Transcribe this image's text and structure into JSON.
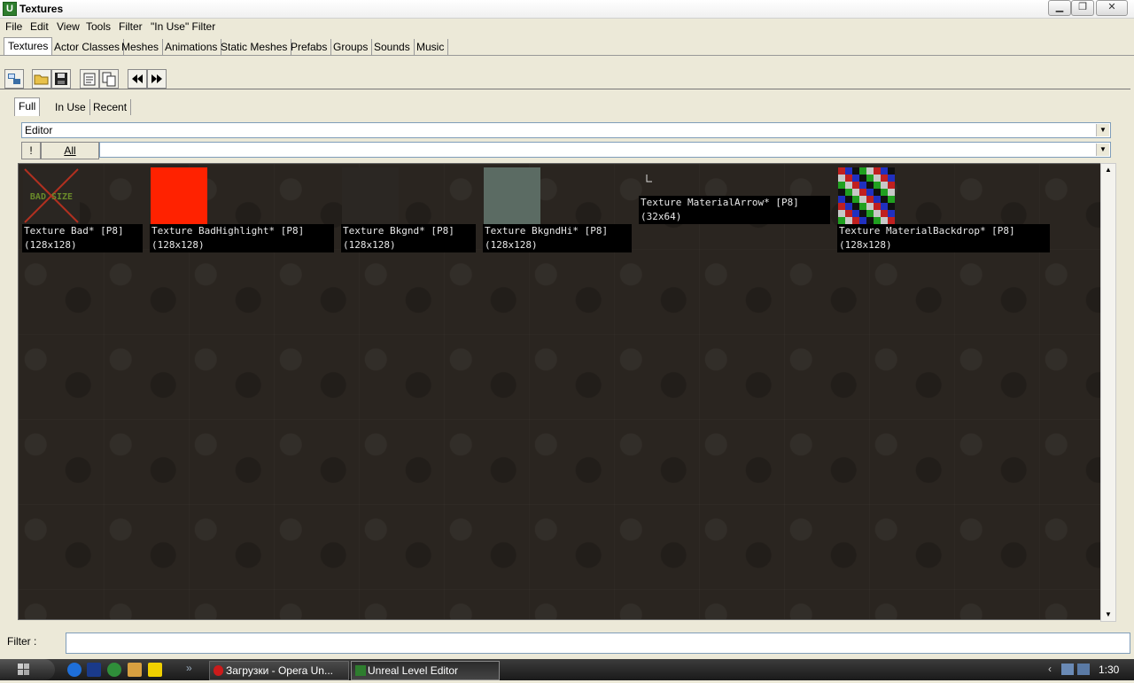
{
  "window": {
    "title": "Textures",
    "app_icon": "U"
  },
  "menu": [
    "File",
    "Edit",
    "View",
    "Tools",
    "Filter",
    "\"In Use\" Filter"
  ],
  "tabs": [
    "Textures",
    "Actor Classes",
    "Meshes",
    "Animations",
    "Static Meshes",
    "Prefabs",
    "Groups",
    "Sounds",
    "Music"
  ],
  "toolbar_icons": [
    "sync-icon",
    "open-folder-icon",
    "save-icon",
    "properties-icon",
    "copy-icon",
    "rewind-icon",
    "fast-forward-icon"
  ],
  "subtabs": [
    "Full",
    "In Use",
    "Recent"
  ],
  "package_combo": {
    "value": "Editor"
  },
  "group_bar": {
    "exclaim_label": "!",
    "all_label": "All",
    "value": ""
  },
  "textures": [
    {
      "name": "Texture Bad* [P8]",
      "size": "(128x128)",
      "thumb_text": "BAD SIZE"
    },
    {
      "name": "Texture BadHighlight* [P8]",
      "size": "(128x128)"
    },
    {
      "name": "Texture Bkgnd* [P8]",
      "size": "(128x128)"
    },
    {
      "name": "Texture BkgndHi* [P8]",
      "size": "(128x128)"
    },
    {
      "name": "Texture MaterialArrow* [P8]",
      "size": "(32x64)"
    },
    {
      "name": "Texture MaterialBackdrop* [P8]",
      "size": "(128x128)"
    }
  ],
  "filter": {
    "label": "Filter :",
    "value": ""
  },
  "taskbar": {
    "tasks": [
      {
        "label": "Загрузки - Opera Un..."
      },
      {
        "label": "Unreal Level Editor"
      }
    ],
    "overflow": "»",
    "clock": "1:30"
  },
  "colors": {
    "bad_highlight": "#ff2200",
    "bkgnd_hi": "#5b6b63",
    "viewport_bg": "#2a2520"
  }
}
